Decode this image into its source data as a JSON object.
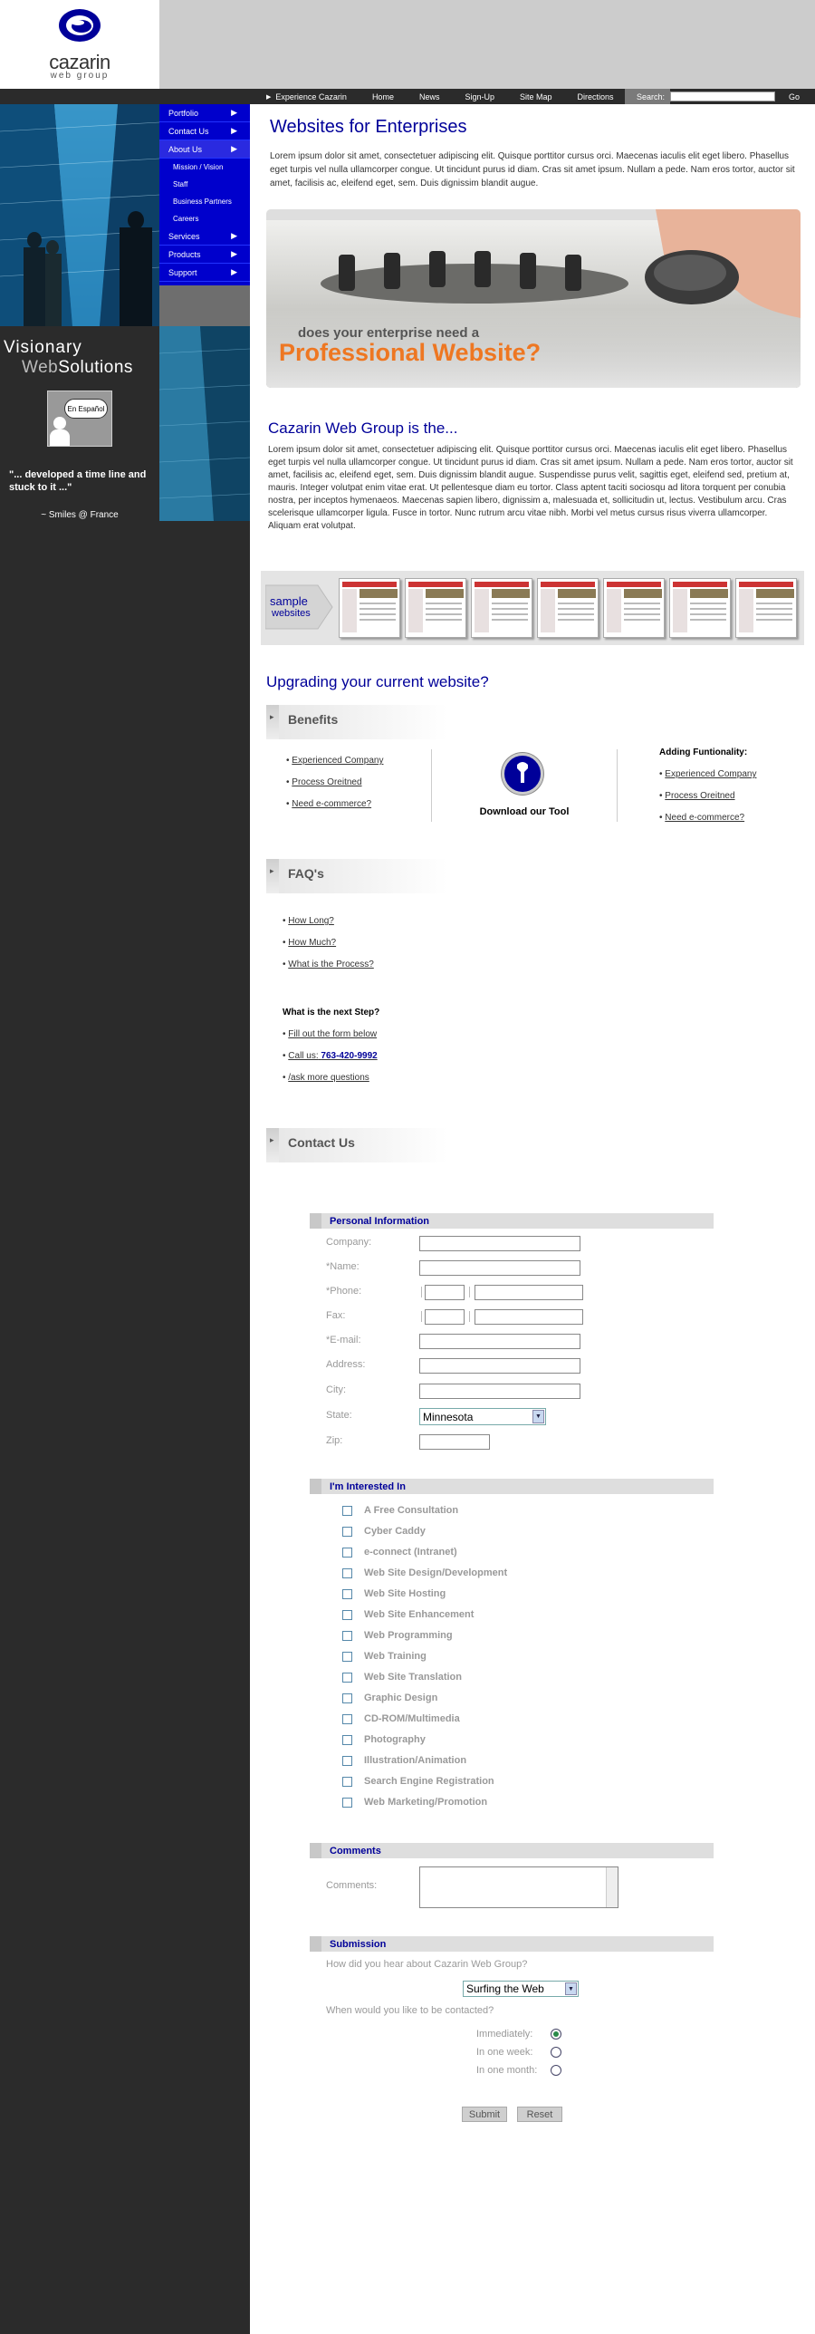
{
  "brand": {
    "name": "cazarin",
    "tagline": "web group"
  },
  "topnav": {
    "items": [
      "Experience Cazarin",
      "Home",
      "News",
      "Sign-Up",
      "Site Map",
      "Directions"
    ],
    "search_label": "Search:",
    "search_value": "",
    "go_label": "Go"
  },
  "sidemenu": {
    "items": [
      "Portfolio",
      "Contact Us",
      "About Us"
    ],
    "sub_items": [
      "Mission / Vision",
      "Staff",
      "Business Partners",
      "Careers"
    ],
    "items_after": [
      "Services",
      "Products",
      "Support"
    ]
  },
  "sidebar": {
    "visionary_1": "Visionary",
    "visionary_2a": "Web",
    "visionary_2b": "Solutions",
    "espanol_label": "En Español",
    "quote": "\"... developed a time line and stuck to it ...\"",
    "quote_author": "~ Smiles @ France"
  },
  "enterprise": {
    "title": "Websites for Enterprises",
    "para": "Lorem ipsum dolor sit amet, consectetuer adipiscing elit. Quisque porttitor cursus orci. Maecenas iaculis elit eget libero. Phasellus eget turpis vel nulla ullamcorper congue. Ut tincidunt purus id diam. Cras sit amet ipsum. Nullam a pede. Nam eros tortor, auctor sit amet, facilisis ac, eleifend eget, sem. Duis dignissim blandit augue.",
    "banner_question": "does your enterprise need a",
    "banner_highlight": "Professional Website?"
  },
  "is_section": {
    "title": "Cazarin Web Group is the...",
    "para": "Lorem ipsum dolor sit amet, consectetuer adipiscing elit. Quisque porttitor cursus orci. Maecenas iaculis elit eget libero. Phasellus eget turpis vel nulla ullamcorper congue. Ut tincidunt purus id diam. Cras sit amet ipsum. Nullam a pede. Nam eros tortor, auctor sit amet, facilisis ac, eleifend eget, sem. Duis dignissim blandit augue. Suspendisse purus velit, sagittis eget, eleifend sed, pretium at, mauris. Integer volutpat enim vitae erat. Ut pellentesque diam eu tortor. Class aptent taciti sociosqu ad litora torquent per conubia nostra, per inceptos hymenaeos. Maecenas sapien libero, dignissim a, malesuada et, sollicitudin ut, lectus. Vestibulum arcu. Cras scelerisque ullamcorper ligula. Fusce in tortor. Nunc rutrum arcu vitae nibh. Morbi vel metus cursus risus viverra ullamcorper. Aliquam erat volutpat."
  },
  "samples": {
    "label_1": "sample",
    "label_2": "websites"
  },
  "upgrade": {
    "title": "Upgrading your current website?",
    "benefits_title": "Benefits",
    "benefits": [
      "Experienced Company",
      "Process Oreitned",
      "Need e-commerce?"
    ],
    "tool_label": "Download our Tool",
    "adding_title": "Adding Funtionality:",
    "adding": [
      "Experienced Company",
      "Process Oreitned",
      "Need e-commerce?"
    ]
  },
  "faq": {
    "title": "FAQ's",
    "items": [
      "How Long?",
      "How Much?",
      "What is the Process?"
    ],
    "next_title": "What is the next Step?",
    "next_form": "Fill out the form below",
    "call_label": "Call us:",
    "call_number": "763-420-9992",
    "next_ask": "/ask more questions"
  },
  "contact": {
    "title": "Contact Us",
    "personal_title": "Personal Information",
    "company": "Company:",
    "name": "*Name:",
    "phone": "*Phone:",
    "fax": "Fax:",
    "email": "*E-mail:",
    "address": "Address:",
    "city": "City:",
    "state": "State:",
    "state_value": "Minnesota",
    "zip": "Zip:",
    "interest_title": "I'm Interested In",
    "interests": [
      "A Free Consultation",
      "Cyber Caddy",
      "e-connect (Intranet)",
      "Web Site Design/Development",
      "Web Site Hosting",
      "Web Site Enhancement",
      "Web Programming",
      "Web Training",
      "Web Site Translation",
      "Graphic Design",
      "CD-ROM/Multimedia",
      "Photography",
      "Illustration/Animation",
      "Search Engine Registration",
      "Web Marketing/Promotion"
    ],
    "comments_title": "Comments",
    "comments_label": "Comments:",
    "comments_value": "",
    "submission_title": "Submission",
    "heard_q": "How did you hear about Cazarin Web Group?",
    "heard_value": "Surfing the Web",
    "when_q": "When would you like to be contacted?",
    "when_options": [
      "Immediately:",
      "In one week:",
      "In one month:"
    ],
    "when_selected": "Immediately:",
    "submit": "Submit",
    "reset": "Reset"
  },
  "colors": {
    "menu_blue": "#0000cc",
    "title_blue": "#000099",
    "dark_bg": "#2b2b2b",
    "accent_orange": "#ee7722"
  }
}
